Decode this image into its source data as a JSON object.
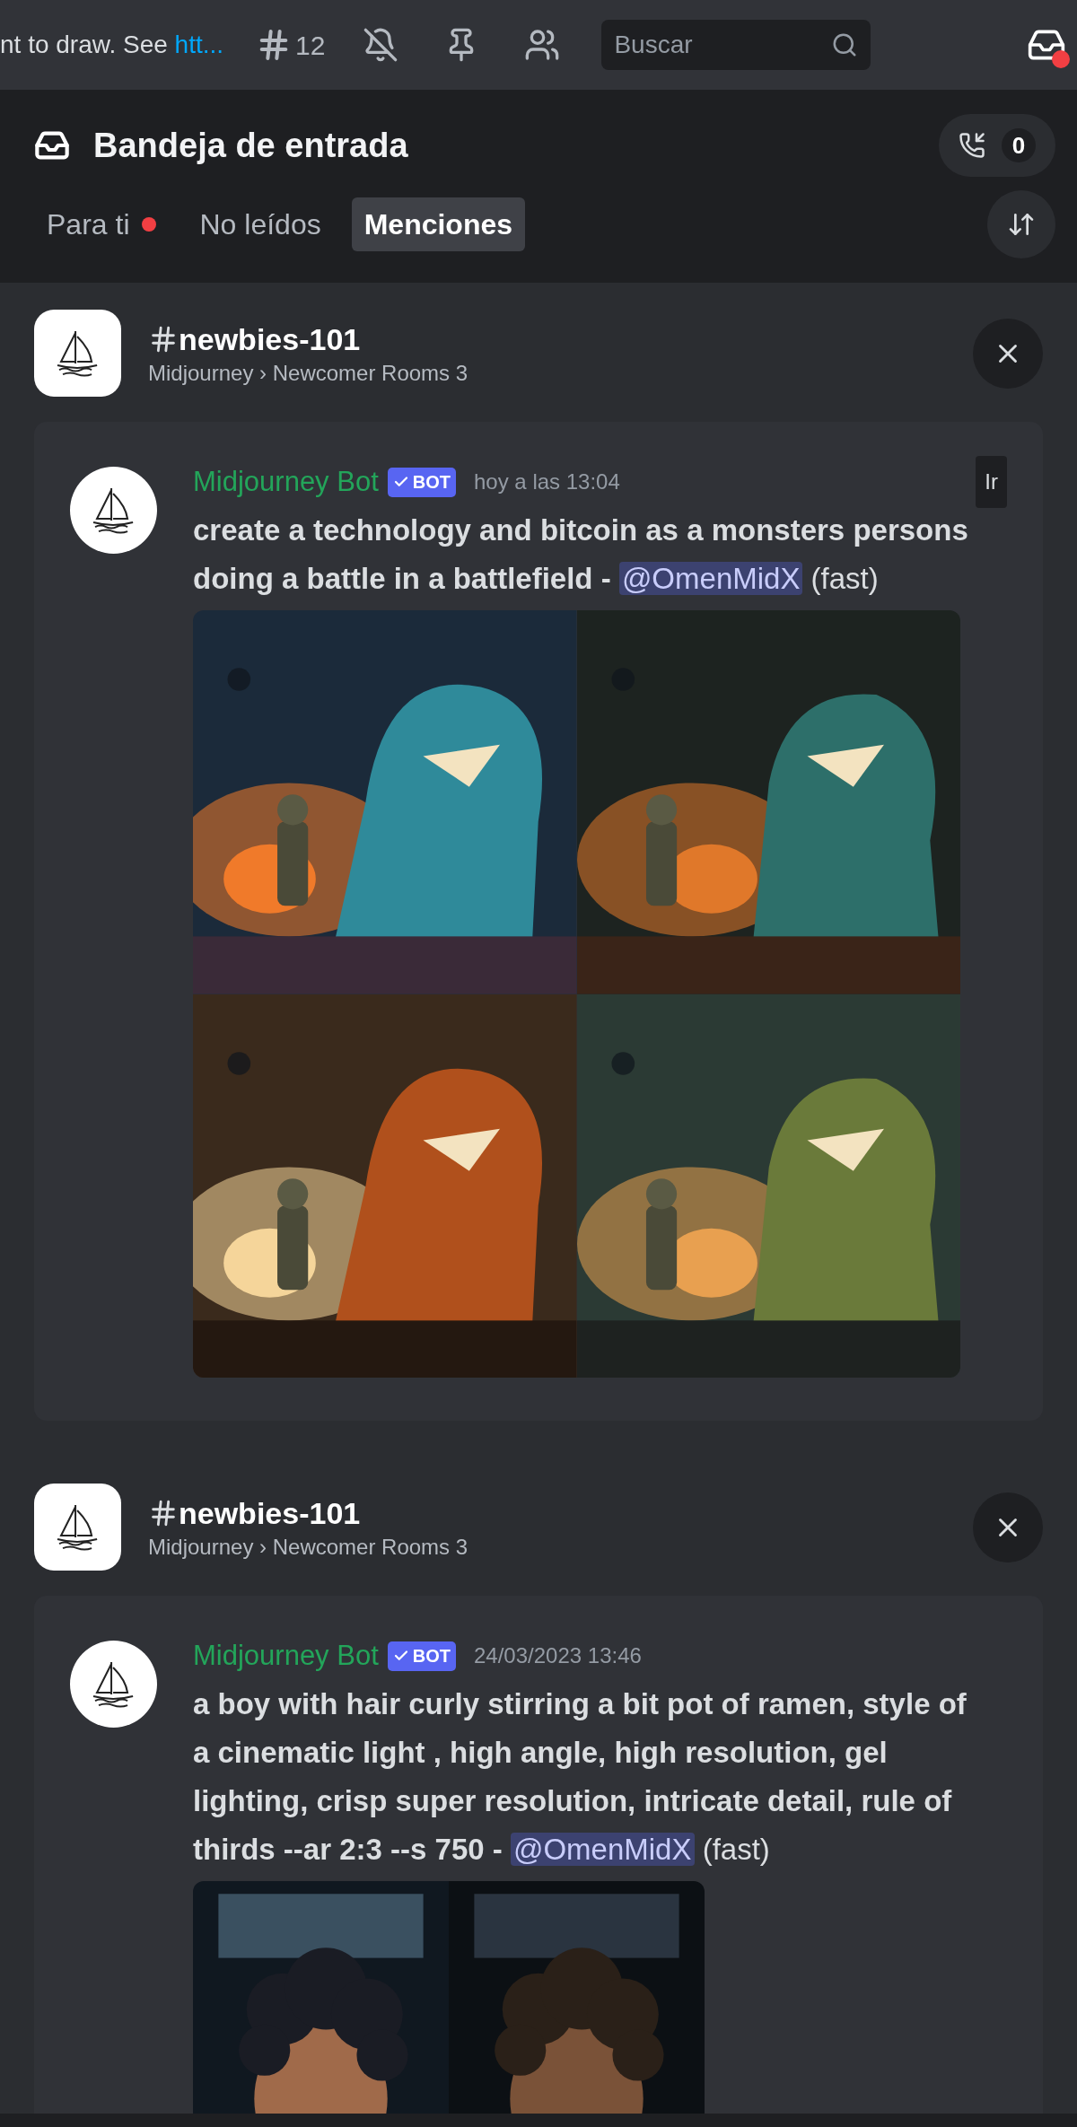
{
  "topbar": {
    "topic": "nt to draw. See ",
    "topic_link": "htt...",
    "threads_count": "12",
    "search": {
      "placeholder": "Buscar"
    }
  },
  "inbox": {
    "title": "Bandeja de entrada",
    "calls_count": "0",
    "tabs": [
      {
        "label": "Para ti",
        "unread": true,
        "selected": false
      },
      {
        "label": "No leídos",
        "unread": false,
        "selected": false
      },
      {
        "label": "Menciones",
        "unread": false,
        "selected": true
      }
    ]
  },
  "mentions": [
    {
      "channel": "newbies-101",
      "path": "Midjourney › Newcomer Rooms 3",
      "message": {
        "author": "Midjourney Bot",
        "badge": "BOT",
        "timestamp": "hoy a las 13:04",
        "jump_label": "Ir",
        "prompt": "create a technology and bitcoin as a monsters persons doing a battle in a battlefield -",
        "mention": "@OmenMidX",
        "suffix": "(fast)"
      }
    },
    {
      "channel": "newbies-101",
      "path": "Midjourney › Newcomer Rooms 3",
      "message": {
        "author": "Midjourney Bot",
        "badge": "BOT",
        "timestamp": "24/03/2023 13:46",
        "prompt": "a boy with hair curly stirring a bit pot of ramen, style of a cinematic light , high angle, high resolution, gel lighting, crisp super resolution, intricate detail, rule of thirds --ar 2:3 --s 750 -",
        "mention": "@OmenMidX",
        "suffix": "(fast)"
      }
    }
  ]
}
